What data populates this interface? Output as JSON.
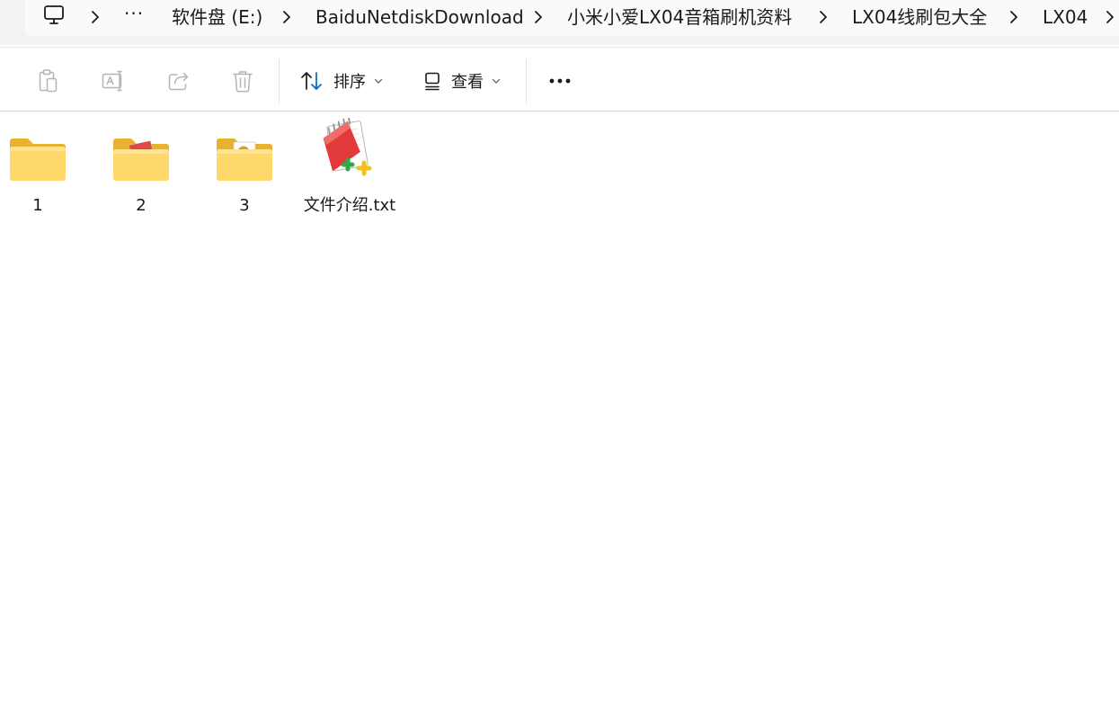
{
  "address_bar": {
    "crumbs": [
      "软件盘 (E:)",
      "BaiduNetdiskDownload",
      "小米小爱LX04音箱刷机资料",
      "LX04线刷包大全",
      "LX04"
    ],
    "overflow_label": "···"
  },
  "toolbar": {
    "sort_label": "排序",
    "view_label": "查看",
    "more_label": "•••"
  },
  "files": [
    {
      "name": "1",
      "type": "folder-plain"
    },
    {
      "name": "2",
      "type": "folder-with-notepad"
    },
    {
      "name": "3",
      "type": "folder-with-doc"
    },
    {
      "name": "文件介绍.txt",
      "type": "text-file"
    }
  ],
  "colors": {
    "folder_back": "#E8B22E",
    "folder_front": "#FFD86B",
    "accent": "#0067C0"
  }
}
